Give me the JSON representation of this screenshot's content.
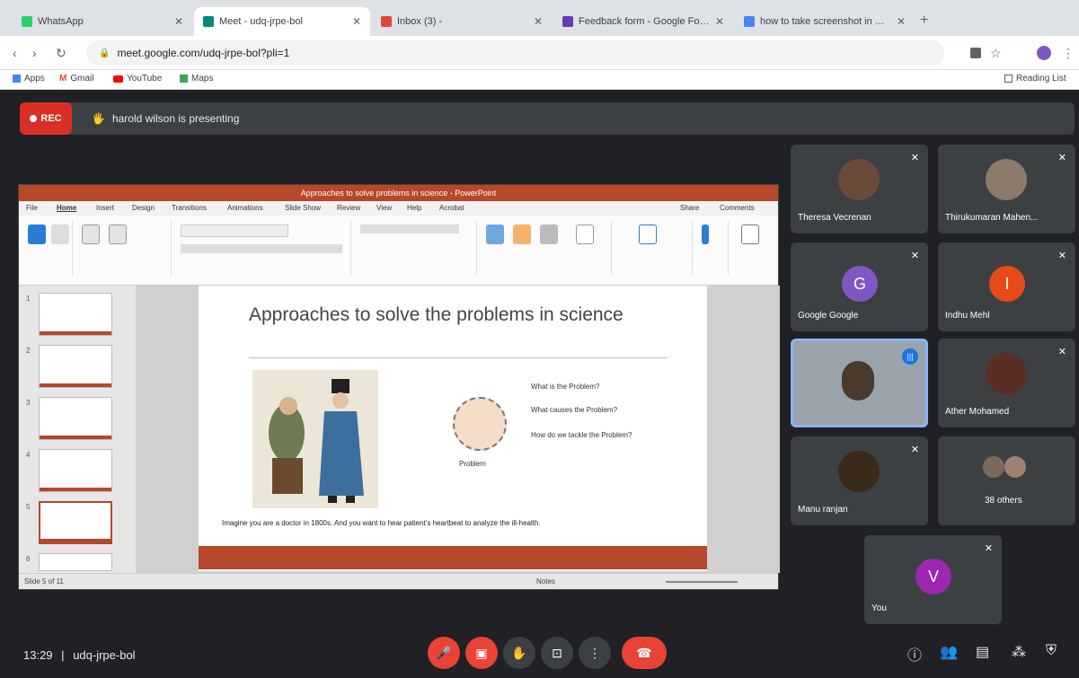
{
  "browser": {
    "tabs": [
      {
        "title": "WhatsApp",
        "color": "#25d366"
      },
      {
        "title": "Meet - udq-jrpe-bol",
        "color": "#00897b"
      },
      {
        "title": "Inbox (3) - ",
        "color": "#ea4335"
      },
      {
        "title": "Feedback form - Google Form",
        "color": "#673ab7"
      },
      {
        "title": "how to take screenshot in mac",
        "color": "#4285f4"
      }
    ],
    "new_tab": "+",
    "url": "meet.google.com/udq-jrpe-bol?pli=1",
    "bookmarks": [
      "Apps",
      "Gmail",
      "YouTube",
      "Maps"
    ],
    "reading_list": "Reading List"
  },
  "meet": {
    "rec_label": "REC",
    "presenting_text": "harold wilson is presenting",
    "meeting_time": "13:29",
    "meeting_code": "udq-jrpe-bol"
  },
  "ppt": {
    "window_title": "Approaches to solve problems in science - PowerPoint",
    "menu_tabs": [
      "File",
      "Home",
      "Insert",
      "Design",
      "Transitions",
      "Animations",
      "Slide Show",
      "Review",
      "View",
      "Help",
      "Acrobat"
    ],
    "share_label": "Share",
    "comments_label": "Comments",
    "status_left": "Slide 5 of 11",
    "status_notes": "Notes",
    "slide": {
      "title": "Approaches to solve the problems in science",
      "circle_label": "Problem",
      "questions": [
        "What is the Problem?",
        "What causes the Problem?",
        "How do we tackle the Problem?"
      ],
      "caption": "Imagine you are a doctor in 1800s. And you want to hear patient's heartbeat to analyze the ill-health."
    },
    "thumb_numbers": [
      "1",
      "2",
      "3",
      "4",
      "5",
      "6"
    ]
  },
  "participants": [
    {
      "name": "Theresa Vecrenan",
      "avatar": "photo"
    },
    {
      "name": "Thirukumaran Mahen...",
      "avatar": "photo"
    },
    {
      "name": "Google Google",
      "initial": "G",
      "color": "#7e57c2"
    },
    {
      "name": "Indhu Mehl",
      "initial": "I",
      "color": "#e64a19"
    },
    {
      "name": "",
      "avatar": "video",
      "speaking": true
    },
    {
      "name": "Ather Mohamed",
      "avatar": "photo"
    },
    {
      "name": "Manu ranjan",
      "avatar": "photo"
    },
    {
      "name": "38 others",
      "avatar": "group"
    },
    {
      "name": "You",
      "initial": "V",
      "color": "#9c27b0"
    }
  ],
  "colors": {
    "accent_red": "#ea4335",
    "ppt_orange": "#b7472a"
  }
}
